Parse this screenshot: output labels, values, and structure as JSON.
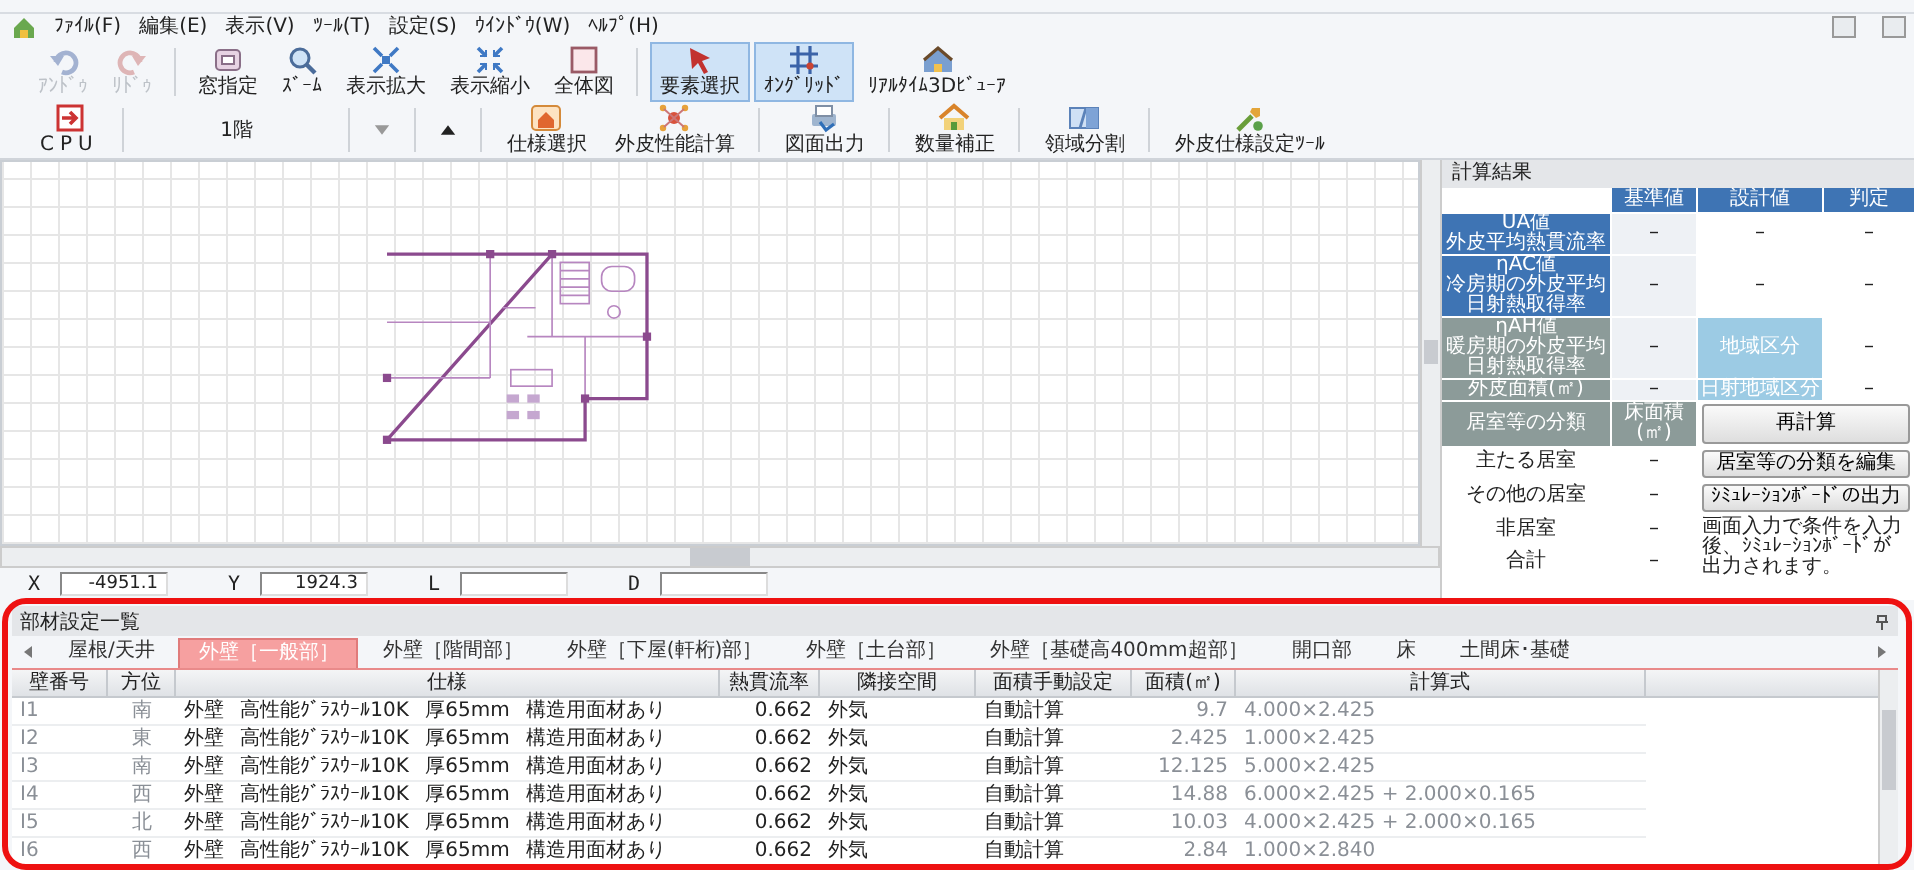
{
  "menu": [
    "ﾌｧｲﾙ(F)",
    "編集(E)",
    "表示(V)",
    "ﾂｰﾙ(T)",
    "設定(S)",
    "ｳｲﾝﾄﾞｳ(W)",
    "ﾍﾙﾌﾟ(H)"
  ],
  "toolbar": [
    {
      "label": "ｱﾝﾄﾞｩ",
      "kind": "undo",
      "disabled": true,
      "selected": false
    },
    {
      "label": "ﾘﾄﾞｩ",
      "kind": "redo",
      "disabled": true,
      "selected": false
    },
    {
      "label": "窓指定",
      "kind": "window",
      "disabled": false,
      "selected": false
    },
    {
      "label": "ｽﾞｰﾑ",
      "kind": "zoom",
      "disabled": false,
      "selected": false
    },
    {
      "label": "表示拡大",
      "kind": "expand",
      "disabled": false,
      "selected": false
    },
    {
      "label": "表示縮小",
      "kind": "shrink",
      "disabled": false,
      "selected": false
    },
    {
      "label": "全体図",
      "kind": "whole",
      "disabled": false,
      "selected": false
    },
    {
      "label": "要素選択",
      "kind": "pointer",
      "disabled": false,
      "selected": true
    },
    {
      "label": "ｵﾝｸﾞﾘｯﾄﾞ",
      "kind": "grid",
      "disabled": false,
      "selected": true
    },
    {
      "label": "ﾘｱﾙﾀｲﾑ3Dﾋﾞｭｰｱ",
      "kind": "house3d",
      "disabled": false,
      "selected": false
    }
  ],
  "toolbar2": {
    "cpu": "CPU",
    "floor": "1階",
    "buttons": [
      {
        "label": "仕様選択",
        "kind": "spec"
      },
      {
        "label": "外皮性能計算",
        "kind": "calc"
      },
      {
        "label": "図面出力",
        "kind": "print"
      },
      {
        "label": "数量補正",
        "kind": "qty"
      },
      {
        "label": "領域分割",
        "kind": "split"
      },
      {
        "label": "外皮仕様設定ﾂｰﾙ",
        "kind": "tool"
      }
    ]
  },
  "coordinates": [
    {
      "label": "X",
      "value": "-4951.1"
    },
    {
      "label": "Y",
      "value": "1924.3"
    },
    {
      "label": "L"
    },
    {
      "label": "D"
    }
  ],
  "results": {
    "title": "計算結果",
    "columns": [
      "基準値",
      "設計値",
      "判定"
    ],
    "metrics": [
      {
        "name": "UA値",
        "description": "外皮平均熱貫流率",
        "color": "#3e74b4",
        "standard": "–",
        "design": "–",
        "highlighted": false,
        "judgement": "–"
      },
      {
        "name": "ηAC値",
        "description": "冷房期の外皮平均日射熱取得率",
        "color": "#3e74b4",
        "standard": "–",
        "design": "–",
        "highlighted": false,
        "judgement": "–"
      },
      {
        "name": "ηAH値",
        "description": "暖房期の外皮平均日射熱取得率",
        "color": "#8c9b99",
        "standard": "–",
        "design": "地域区分",
        "highlighted": true,
        "judgement": "–"
      },
      {
        "name": "外皮面積(㎡)",
        "color": "#8c9b99",
        "standard": "–",
        "design": "日射地域区分",
        "highlighted": true,
        "judgement": "–"
      }
    ],
    "room_header": [
      "居室等の分類",
      "床面積(㎡)"
    ],
    "rooms": [
      {
        "name": "主たる居室",
        "area": "–"
      },
      {
        "name": "その他の居室",
        "area": "–"
      },
      {
        "name": "非居室",
        "area": "–"
      },
      {
        "name": "合計",
        "area": "–"
      }
    ],
    "buttons": [
      "再計算",
      "居室等の分類を編集",
      "ｼﾐｭﾚｰｼｮﾝﾎﾞｰﾄﾞの出力"
    ],
    "note": "画面入力で条件を入力後、ｼﾐｭﾚｰｼｮﾝﾎﾞｰﾄﾞが出力されます。"
  },
  "parts": {
    "title": "部材設定一覧",
    "tabs": [
      {
        "label": "屋根/天井",
        "selected": false
      },
      {
        "label": "外壁［一般部］",
        "selected": true
      },
      {
        "label": "外壁［階間部］",
        "selected": false
      },
      {
        "label": "外壁［下屋(軒桁)部］",
        "selected": false
      },
      {
        "label": "外壁［土台部］",
        "selected": false
      },
      {
        "label": "外壁［基礎高400mm超部］",
        "selected": false
      },
      {
        "label": "開口部",
        "selected": false
      },
      {
        "label": "床",
        "selected": false
      },
      {
        "label": "土間床･基礎",
        "selected": false
      }
    ],
    "columns": [
      "壁番号",
      "方位",
      "仕様",
      "熱貫流率",
      "隣接空間",
      "面積手動設定",
      "面積(㎡)",
      "計算式"
    ],
    "rows": [
      [
        "I1",
        "南",
        "外壁 高性能ｸﾞﾗｽｳｰﾙ10K 厚65mm 構造用面材あり",
        "0.662",
        "外気",
        "自動計算",
        "9.7",
        "4.000×2.425"
      ],
      [
        "I2",
        "東",
        "外壁 高性能ｸﾞﾗｽｳｰﾙ10K 厚65mm 構造用面材あり",
        "0.662",
        "外気",
        "自動計算",
        "2.425",
        "1.000×2.425"
      ],
      [
        "I3",
        "南",
        "外壁 高性能ｸﾞﾗｽｳｰﾙ10K 厚65mm 構造用面材あり",
        "0.662",
        "外気",
        "自動計算",
        "12.125",
        "5.000×2.425"
      ],
      [
        "I4",
        "西",
        "外壁 高性能ｸﾞﾗｽｳｰﾙ10K 厚65mm 構造用面材あり",
        "0.662",
        "外気",
        "自動計算",
        "14.88",
        "6.000×2.425 + 2.000×0.165"
      ],
      [
        "I5",
        "北",
        "外壁 高性能ｸﾞﾗｽｳｰﾙ10K 厚65mm 構造用面材あり",
        "0.662",
        "外気",
        "自動計算",
        "10.03",
        "4.000×2.425 + 2.000×0.165"
      ],
      [
        "I6",
        "西",
        "外壁 高性能ｸﾞﾗｽｳｰﾙ10K 厚65mm 構造用面材あり",
        "0.662",
        "外気",
        "自動計算",
        "2.84",
        "1.000×2.840"
      ]
    ]
  }
}
